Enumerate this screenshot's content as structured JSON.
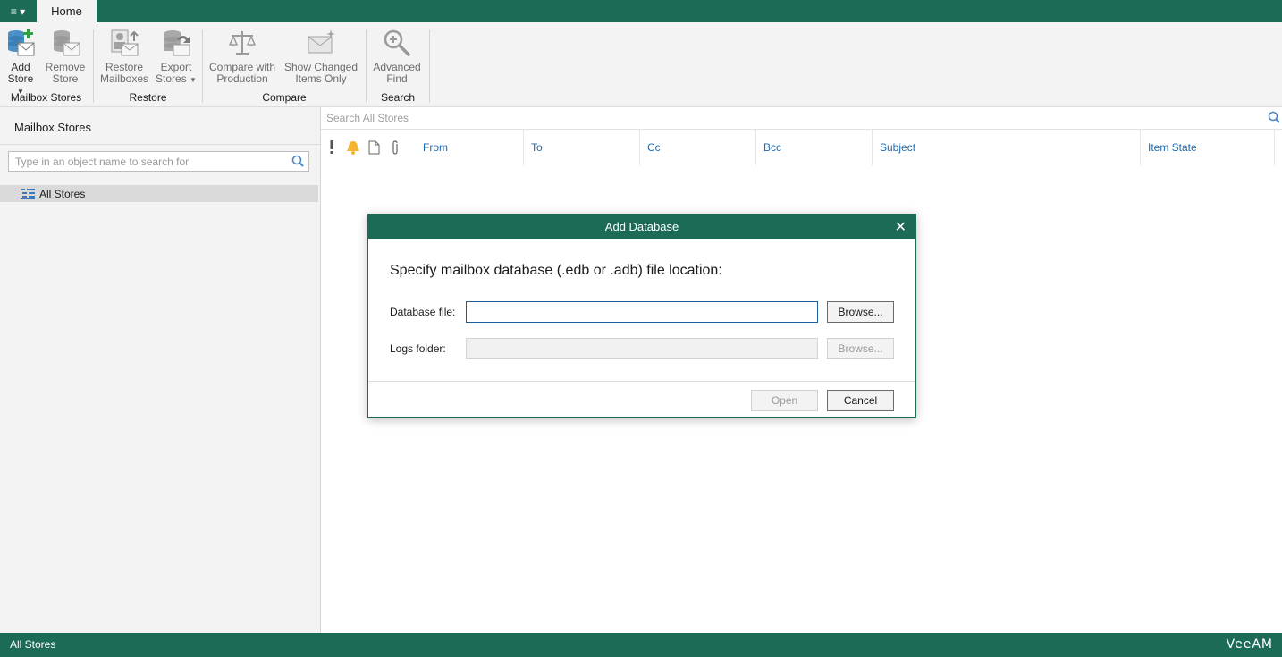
{
  "app": {
    "menu_button": "≡ ▾",
    "home_tab": "Home"
  },
  "ribbon": {
    "groups": [
      {
        "label": "Mailbox Stores"
      },
      {
        "label": "Restore"
      },
      {
        "label": "Compare"
      },
      {
        "label": "Search"
      }
    ],
    "buttons": {
      "add_store": {
        "line1": "Add",
        "line2": "Store",
        "icon": "database-add-icon"
      },
      "remove_store": {
        "line1": "Remove",
        "line2": "Store",
        "icon": "database-remove-icon"
      },
      "restore_mailboxes": {
        "line1": "Restore",
        "line2": "Mailboxes",
        "icon": "restore-icon"
      },
      "export_stores": {
        "line1": "Export",
        "line2": "Stores",
        "icon": "export-icon"
      },
      "compare_production": {
        "line1": "Compare with",
        "line2": "Production",
        "icon": "scales-icon"
      },
      "show_changed": {
        "line1": "Show Changed",
        "line2": "Items Only",
        "icon": "envelope-star-icon"
      },
      "advanced_find": {
        "line1": "Advanced",
        "line2": "Find",
        "icon": "magnifier-icon"
      }
    }
  },
  "left_panel": {
    "title": "Mailbox Stores",
    "search_placeholder": "Type in an object name to search for",
    "tree": [
      {
        "label": "All Stores"
      }
    ]
  },
  "main": {
    "search_placeholder": "Search All Stores",
    "columns": [
      "From",
      "To",
      "Cc",
      "Bcc",
      "Subject",
      "Item State"
    ]
  },
  "dialog": {
    "title": "Add Database",
    "heading": "Specify mailbox database (.edb or .adb) file location:",
    "database_label": "Database file:",
    "database_value": "",
    "logs_label": "Logs folder:",
    "logs_value": "",
    "browse_label": "Browse...",
    "open_label": "Open",
    "cancel_label": "Cancel"
  },
  "status": {
    "text": "All Stores",
    "logo": "VeeAM"
  },
  "colors": {
    "brand": "#1c6b57",
    "column_header": "#1e6bb0"
  }
}
